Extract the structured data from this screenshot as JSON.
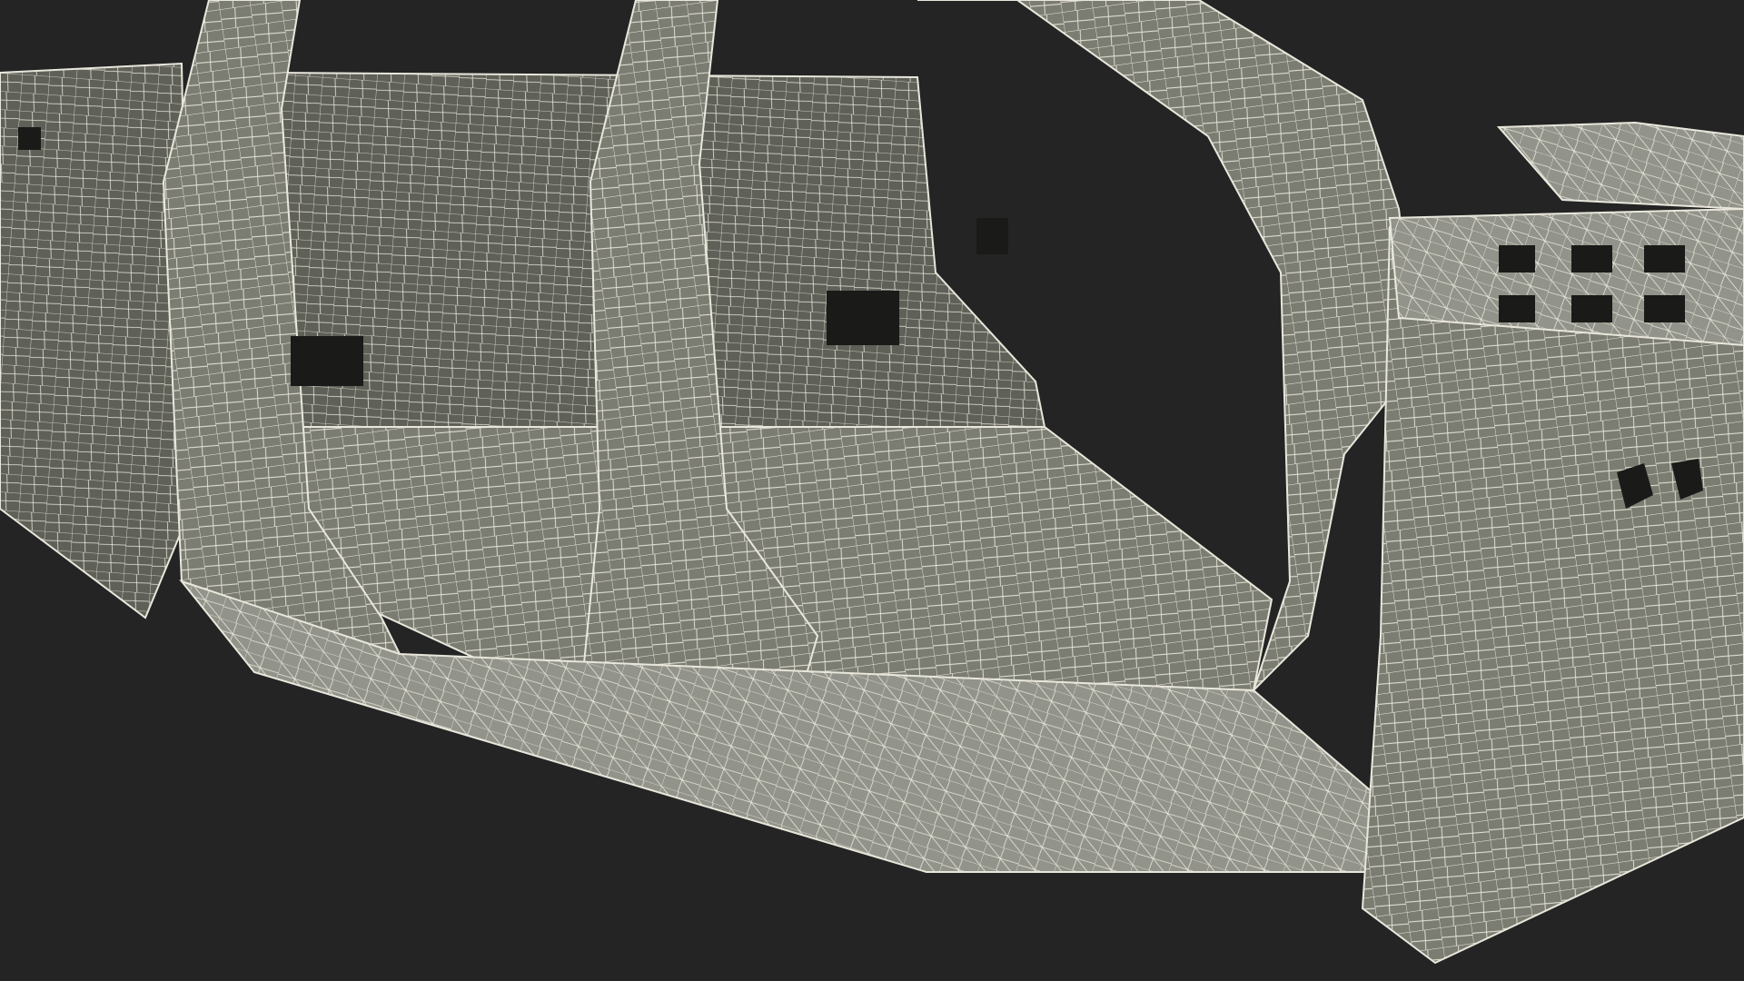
{
  "scene": {
    "subject": "car-body-frame-wireframe",
    "background_color": "#242424",
    "surface_color": "#7c7d72",
    "surface_dark_color": "#5f6058",
    "surface_light_color": "#92938a",
    "wire_color": "#e9e7dc",
    "shadow_color": "#1a1a18"
  }
}
